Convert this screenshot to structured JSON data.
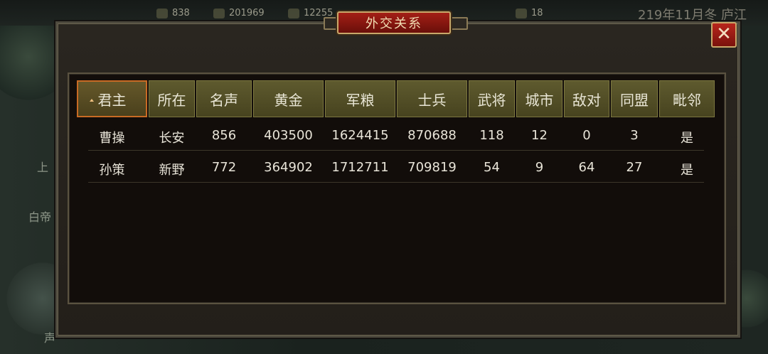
{
  "top_bar": {
    "resources": [
      {
        "icon": "resource-1-icon",
        "value": "838"
      },
      {
        "icon": "resource-2-icon",
        "value": "201969"
      },
      {
        "icon": "resource-3-icon",
        "value": "12255"
      },
      {
        "icon": "resource-4-icon",
        "value": "18"
      }
    ],
    "date_location": "219年11月冬 庐江"
  },
  "side_labels": [
    "上",
    "白帝",
    "声"
  ],
  "dialog": {
    "title": "外交关系",
    "close_label": "✕"
  },
  "table": {
    "headers": [
      "君主",
      "所在",
      "名声",
      "黄金",
      "军粮",
      "士兵",
      "武将",
      "城市",
      "敌对",
      "同盟",
      "毗邻"
    ],
    "rows": [
      [
        "曹操",
        "长安",
        "856",
        "403500",
        "1624415",
        "870688",
        "118",
        "12",
        "0",
        "3",
        "是"
      ],
      [
        "孙策",
        "新野",
        "772",
        "364902",
        "1712711",
        "709819",
        "54",
        "9",
        "64",
        "27",
        "是"
      ]
    ],
    "sorted_column": "君主"
  },
  "colors": {
    "title_plate": "#a31f16",
    "header_bg": "#5e5a2e",
    "active_header_border": "#c86a24",
    "panel_bg": "#120d0a"
  }
}
